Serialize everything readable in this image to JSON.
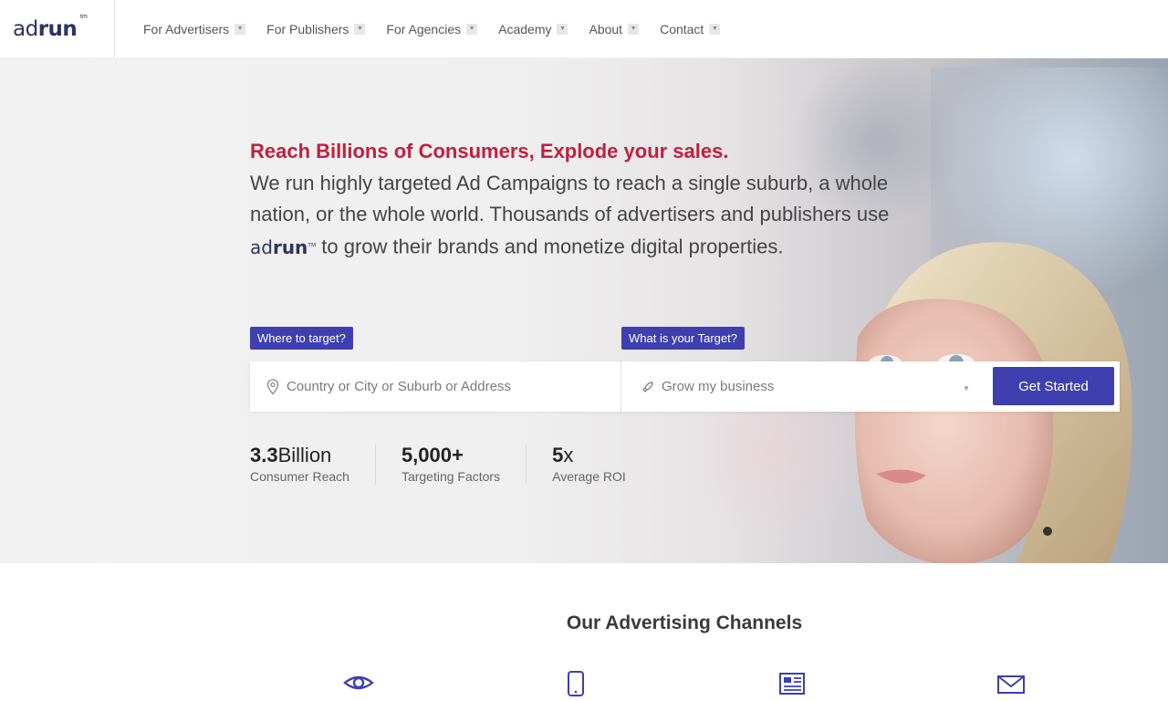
{
  "brand": {
    "logo_text_light": "ad",
    "logo_text_bold": "run",
    "logo_tm": "tm",
    "accent": "#3f3faf",
    "headline_color": "#c0203f"
  },
  "nav": {
    "items": [
      {
        "label": "For Advertisers"
      },
      {
        "label": "For Publishers"
      },
      {
        "label": "For Agencies"
      },
      {
        "label": "Academy"
      },
      {
        "label": "About"
      },
      {
        "label": "Contact"
      }
    ]
  },
  "hero": {
    "title": "Reach Billions of Consumers, Explode your sales.",
    "desc_part1": "We run highly targeted Ad Campaigns to reach a single suburb, a whole nation, or the whole world. Thousands of advertisers and publishers use ",
    "desc_part2": " to grow their brands and monetize digital properties.",
    "inline_logo_light": "ad",
    "inline_logo_bold": "run",
    "inline_logo_tm": "TM"
  },
  "search": {
    "where_label": "Where to target?",
    "target_label": "What is your Target?",
    "location_placeholder": "Country or City or Suburb or Address",
    "target_value": "Grow my business",
    "submit_label": "Get Started"
  },
  "stats": [
    {
      "value_bold": "3.3",
      "value_rest": "Billion",
      "label": "Consumer Reach"
    },
    {
      "value_bold": "5,000+",
      "value_rest": "",
      "label": "Targeting Factors"
    },
    {
      "value_bold": "5",
      "value_rest": "x",
      "label": "Average ROI"
    }
  ],
  "channels": {
    "title": "Our Advertising Channels",
    "icons": [
      "eye-icon",
      "mobile-icon",
      "newspaper-icon",
      "envelope-icon"
    ]
  }
}
